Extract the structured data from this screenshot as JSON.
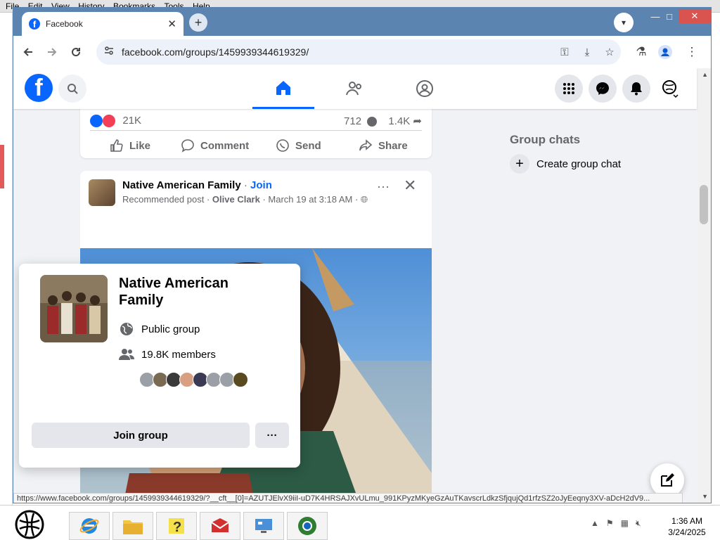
{
  "background_window": {
    "menu": [
      "File",
      "Edit",
      "View",
      "History",
      "Bookmarks",
      "Tools",
      "Help"
    ]
  },
  "browser": {
    "tab_title": "Facebook",
    "url": "facebook.com/groups/1459939344619329/",
    "status_url": "https://www.facebook.com/groups/1459939344619329/?__cft__[0]=AZUTJElvX9iiI-uD7K4HRSAJXvULmu_991KPyzMKyeGzAuTKavscrLdkzSfjqujQd1rfzSZ2oJyEeqny3XV-aDcH2dV9..."
  },
  "post1": {
    "reactions": "21K",
    "comments": "712",
    "shares": "1.4K",
    "actions": {
      "like": "Like",
      "comment": "Comment",
      "send": "Send",
      "share": "Share"
    }
  },
  "post2": {
    "group_name": "Native American Family",
    "separator": "·",
    "join": "Join",
    "recommended": "Recommended post",
    "author": "Olive Clark",
    "date": "March 19 at 3:18 AM",
    "dots": "···"
  },
  "hovercard": {
    "title": "Native American Family",
    "privacy": "Public group",
    "members": "19.8K members",
    "join_button": "Join group",
    "more_button": "···"
  },
  "sidebar": {
    "group_chats_title": "Group chats",
    "create_group_chat": "Create group chat"
  },
  "taskbar": {
    "time": "1:36 AM",
    "date": "3/24/2025"
  },
  "colors": {
    "facebook_blue": "#0866ff",
    "chrome_frame": "#5b84b1",
    "page_bg": "#f0f2f5"
  }
}
